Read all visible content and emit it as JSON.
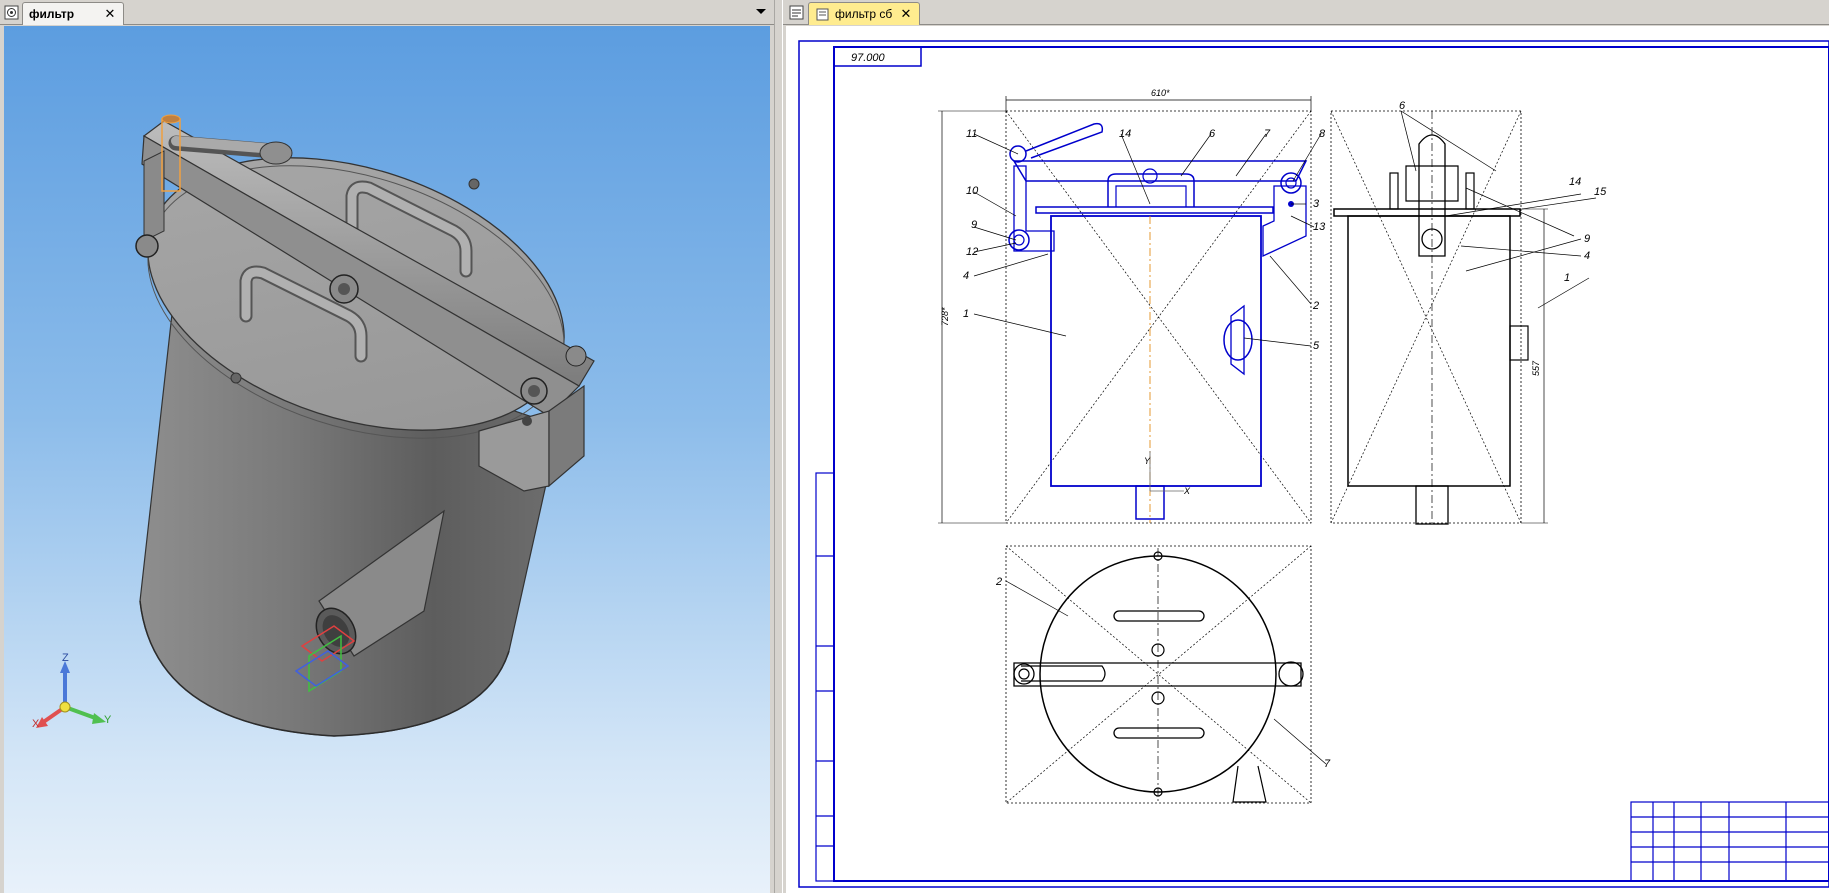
{
  "left_pane": {
    "tab_label": "фильтр",
    "tab_close": "✕",
    "axes": {
      "x": "X",
      "y": "Y",
      "z": "Z"
    }
  },
  "right_pane": {
    "tab_label": "фильтр сб",
    "tab_close": "✕",
    "drawing": {
      "designation": "97.000",
      "dimensions": {
        "width_top": "610*",
        "height_left": "728*",
        "height_right": "557"
      },
      "view_axes": {
        "x": "X",
        "y": "Y"
      },
      "callouts": [
        "1",
        "2",
        "3",
        "4",
        "5",
        "6",
        "7",
        "8",
        "9",
        "10",
        "11",
        "12",
        "13",
        "14",
        "15"
      ]
    }
  },
  "colors": {
    "viewport_top": "#5c9de0",
    "viewport_bottom": "#e8f1fa",
    "active_tab": "#ffec8f",
    "geometry_blue": "#0000cc",
    "model_gray": "#8a8a8a"
  }
}
